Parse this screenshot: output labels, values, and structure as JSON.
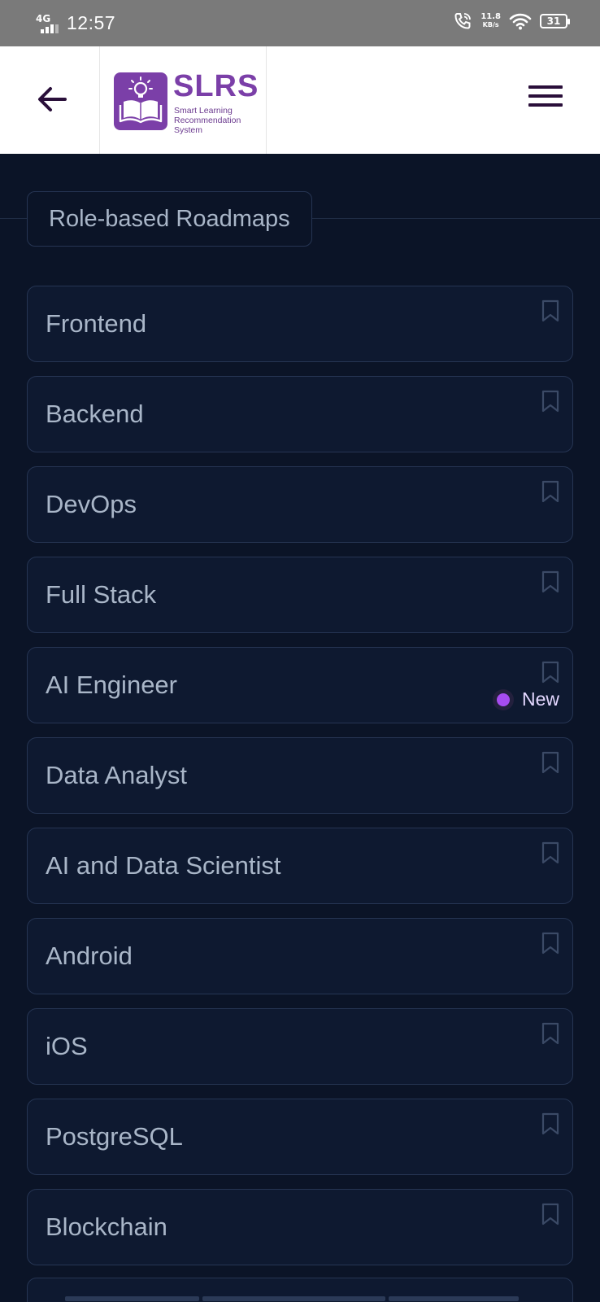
{
  "status_bar": {
    "network": "4G",
    "time": "12:57",
    "speed_value": "11.8",
    "speed_unit": "KB/s",
    "battery": "31"
  },
  "header": {
    "back_icon": "arrow-left-icon",
    "logo_title": "SLRS",
    "logo_subtitle": "Smart Learning Recommendation System",
    "menu_icon": "hamburger-menu-icon",
    "brand_color": "#7b3fa8"
  },
  "section": {
    "title": "Role-based Roadmaps"
  },
  "roadmaps": [
    {
      "label": "Frontend"
    },
    {
      "label": "Backend"
    },
    {
      "label": "DevOps"
    },
    {
      "label": "Full Stack"
    },
    {
      "label": "AI Engineer",
      "badge": "New"
    },
    {
      "label": "Data Analyst"
    },
    {
      "label": "AI and Data Scientist"
    },
    {
      "label": "Android"
    },
    {
      "label": "iOS"
    },
    {
      "label": "PostgreSQL"
    },
    {
      "label": "Blockchain"
    }
  ],
  "colors": {
    "background": "#0b1427",
    "card": "#0e1930",
    "card_border": "#263553",
    "text": "#a9b6c8",
    "badge_dot": "#a64cf0"
  }
}
